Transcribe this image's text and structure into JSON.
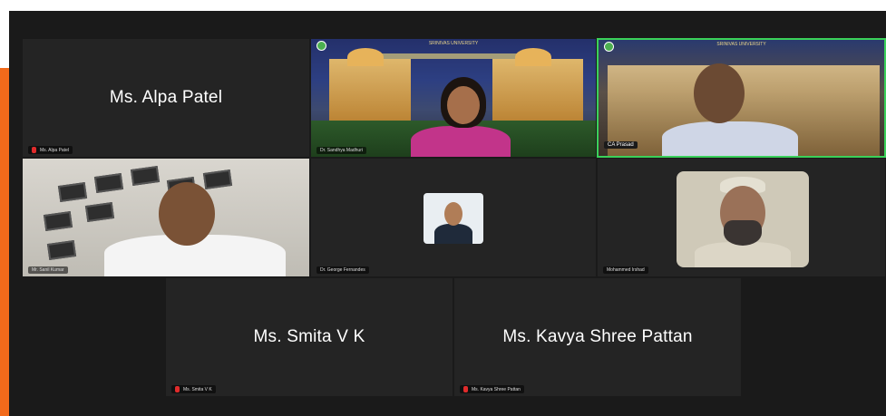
{
  "participants": [
    {
      "center_name": "Ms. Alpa Patel",
      "tag": "Ms. Alpa Patel"
    },
    {
      "tag": "Dr. Sandhya Madhuri",
      "banner": "SRINIVAS UNIVERSITY"
    },
    {
      "tag": "CA Prasad",
      "banner": "SRINIVAS UNIVERSITY"
    },
    {
      "tag": "Mr. Sanil Kumar"
    },
    {
      "tag": "Dr. George Fernandes"
    },
    {
      "tag": "Mohammed Irshad"
    },
    {
      "center_name": "Ms. Smita V K",
      "tag": "Ms. Smita V K"
    },
    {
      "center_name": "Ms. Kavya Shree Pattan",
      "tag": "Ms. Kavya Shree Pattan"
    }
  ],
  "colors": {
    "accent": "#f26a1b",
    "active_speaker": "#3ad15a",
    "muted": "#e02b2b",
    "meeting_bg": "#1a1a1a",
    "tile_bg": "#242424"
  }
}
